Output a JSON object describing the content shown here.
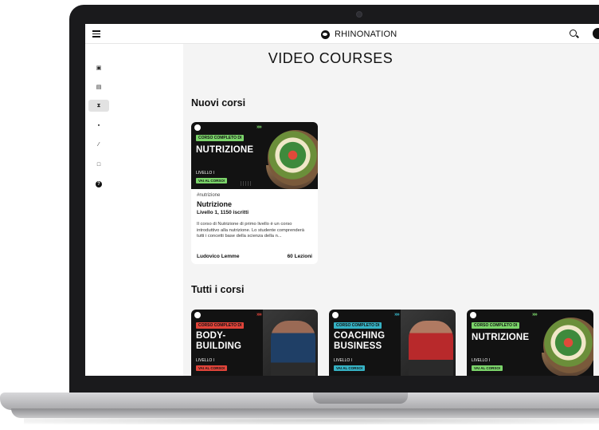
{
  "app": {
    "brand": "RHINONATION"
  },
  "colors": {
    "accent_green": "#7bd46a",
    "accent_red": "#e0443a",
    "accent_teal": "#36b2c4",
    "card_dark": "#121212"
  },
  "sidebar": {
    "items": [
      {
        "icon": "dashboard-icon",
        "glyph": "▣"
      },
      {
        "icon": "film-icon",
        "glyph": "▤"
      },
      {
        "icon": "hourglass-icon",
        "glyph": "⧗"
      },
      {
        "icon": "book-icon",
        "glyph": "▪"
      },
      {
        "icon": "pen-icon",
        "glyph": "⁄"
      },
      {
        "icon": "monitor-icon",
        "glyph": "□"
      },
      {
        "icon": "help-icon",
        "glyph": "?"
      }
    ],
    "active_index": 2
  },
  "main": {
    "title": "VIDEO COURSES",
    "new_section_title": "Nuovi corsi",
    "all_section_title": "Tutti i corsi"
  },
  "featured": {
    "tag": "CORSO COMPLETO DI",
    "thumb_title": "NUTRIZIONE",
    "level": "LIVELLO I",
    "cta": "VAI AL CORSO!",
    "arrows": "»»",
    "hashtag": "#nutrizione",
    "name": "Nutrizione",
    "meta": "Livello 1, 1150 iscritti",
    "description": "Il corso di Nutrizione di primo livello è un corso introduttivo alla nutrizione. Lo studente comprenderà tutti i concetti base della scienza della n...",
    "author": "Ludovico Lemme",
    "lessons": "60 Lezioni"
  },
  "all_courses": [
    {
      "tag": "CORSO COMPLETO DI",
      "title_line1": "BODY-",
      "title_line2": "BUILDING",
      "level": "LIVELLO I",
      "cta": "VAI AL CORSO!",
      "arrows": "»»"
    },
    {
      "tag": "CORSO COMPLETO DI",
      "title_line1": "COACHING",
      "title_line2": "BUSINESS",
      "level": "LIVELLO I",
      "cta": "VAI AL CORSO!",
      "arrows": "»»"
    },
    {
      "tag": "CORSO COMPLETO DI",
      "title_line1": "NUTRIZIONE",
      "title_line2": "",
      "level": "LIVELLO I",
      "cta": "VAI AL CORSO!",
      "arrows": "»»"
    }
  ]
}
